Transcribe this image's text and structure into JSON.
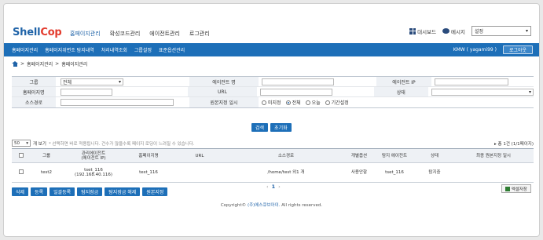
{
  "header": {
    "logo_main": "Shell",
    "logo_accent": "Cop",
    "menu": [
      "홈페이지관리",
      "확성코드관리",
      "에이전트관리",
      "로그관리"
    ],
    "dashboard_label": "대시보드",
    "message_label": "메시지",
    "settings_select": "설정"
  },
  "nav": {
    "items": [
      "홈페이지관리",
      "홈페이지위변조 탐지내역",
      "처리내역조회",
      "그룹설정",
      "표준옵션관리"
    ],
    "user": "KMW ( yagami99 )",
    "logout": "로그아웃"
  },
  "breadcrumb": {
    "first": "홈페이지관리",
    "second": "홈페이지관리"
  },
  "form": {
    "group_label": "그룹",
    "group_value": "전체",
    "agent_name_label": "에이전트 명",
    "agent_ip_label": "에이전트 IP",
    "homepage_name_label": "홈페이지명",
    "url_label": "URL",
    "status_label": "상태",
    "source_path_label": "소스경로",
    "original_date_label": "원본지정 일시",
    "radio_options": [
      "미지정",
      "전체",
      "오늘",
      "기간설정"
    ]
  },
  "buttons": {
    "search": "검색",
    "reset": "초기화"
  },
  "list": {
    "page_size": "50",
    "page_size_suffix": "개 보기",
    "note": "* 선택하면 바로 적용됩니다. 건수가 많을수록 페이지 로딩이 느려질 수 있습니다.",
    "total": "▸ 총 1건 (1/1페이지)"
  },
  "table": {
    "headers": [
      "그룹",
      "관리에이전트\n(에이전트 IP)",
      "홈페이지명",
      "URL",
      "소스경로",
      "개별옵션",
      "탐지 에이전트",
      "상태",
      "최종 원본지정 일시"
    ],
    "rows": [
      {
        "group": "test2",
        "agent_line1": "tset_116",
        "agent_line2": "(192.168.40.116)",
        "homepage": "test_116",
        "url": "",
        "source": "/home/test 외1 개",
        "option": "사용안함",
        "detect_agent": "tset_116",
        "status": "탐지중",
        "last_date": ""
      }
    ]
  },
  "pager": {
    "prev": "‹",
    "current": "1",
    "next": "›"
  },
  "actions": [
    "삭제",
    "등록",
    "일괄등록",
    "탐지잠금",
    "탐지잠금 해제",
    "원본지정"
  ],
  "excel_label": "엑셀저장",
  "footer": {
    "prefix": "Copyright© ",
    "brand": "(주)에스큐브아이.",
    "suffix": " All rights reserved."
  }
}
